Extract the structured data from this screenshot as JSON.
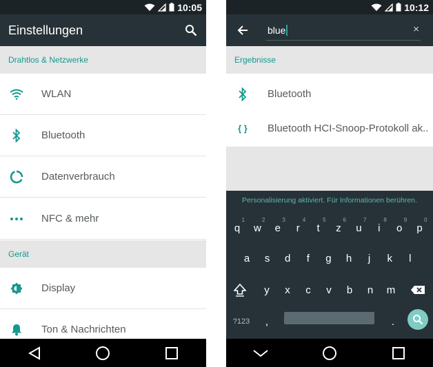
{
  "left": {
    "status_time": "10:05",
    "app_title": "Einstellungen",
    "sections": [
      {
        "header": "Drahtlos & Netzwerke",
        "items": [
          "WLAN",
          "Bluetooth",
          "Datenverbrauch",
          "NFC & mehr"
        ]
      },
      {
        "header": "Gerät",
        "items": [
          "Display",
          "Ton & Nachrichten"
        ]
      }
    ],
    "icons": {
      "search": "search-icon",
      "wifi": "wifi-icon",
      "bluetooth": "bluetooth-icon",
      "data": "data-usage-icon",
      "more": "more-icon",
      "display": "brightness-icon",
      "sound": "bell-icon"
    }
  },
  "right": {
    "status_time": "10:12",
    "search": {
      "value": "blue",
      "clear": "×"
    },
    "results_header": "Ergebnisse",
    "results": [
      "Bluetooth",
      "Bluetooth HCI-Snoop-Protokoll ak.."
    ],
    "result_icons": [
      "bluetooth-icon",
      "{ }"
    ],
    "suggestion_text": "Personalisierung aktiviert. Für Informationen berühren.",
    "keyboard": {
      "row1": [
        {
          "k": "q",
          "n": "1"
        },
        {
          "k": "w",
          "n": "2"
        },
        {
          "k": "e",
          "n": "3"
        },
        {
          "k": "r",
          "n": "4"
        },
        {
          "k": "t",
          "n": "5"
        },
        {
          "k": "z",
          "n": "6"
        },
        {
          "k": "u",
          "n": "7"
        },
        {
          "k": "i",
          "n": "8"
        },
        {
          "k": "o",
          "n": "9"
        },
        {
          "k": "p",
          "n": "0"
        }
      ],
      "row2": [
        "a",
        "s",
        "d",
        "f",
        "g",
        "h",
        "j",
        "k",
        "l"
      ],
      "row3": [
        "y",
        "x",
        "c",
        "v",
        "b",
        "n",
        "m"
      ],
      "symbols_key": "?123",
      "comma_key": ",",
      "period_key": "."
    }
  },
  "colors": {
    "accent": "#16988e",
    "appbar": "#273238",
    "statusbar": "#1c2326",
    "keyboard": "#263238",
    "section_bg": "#e6e6e6"
  }
}
